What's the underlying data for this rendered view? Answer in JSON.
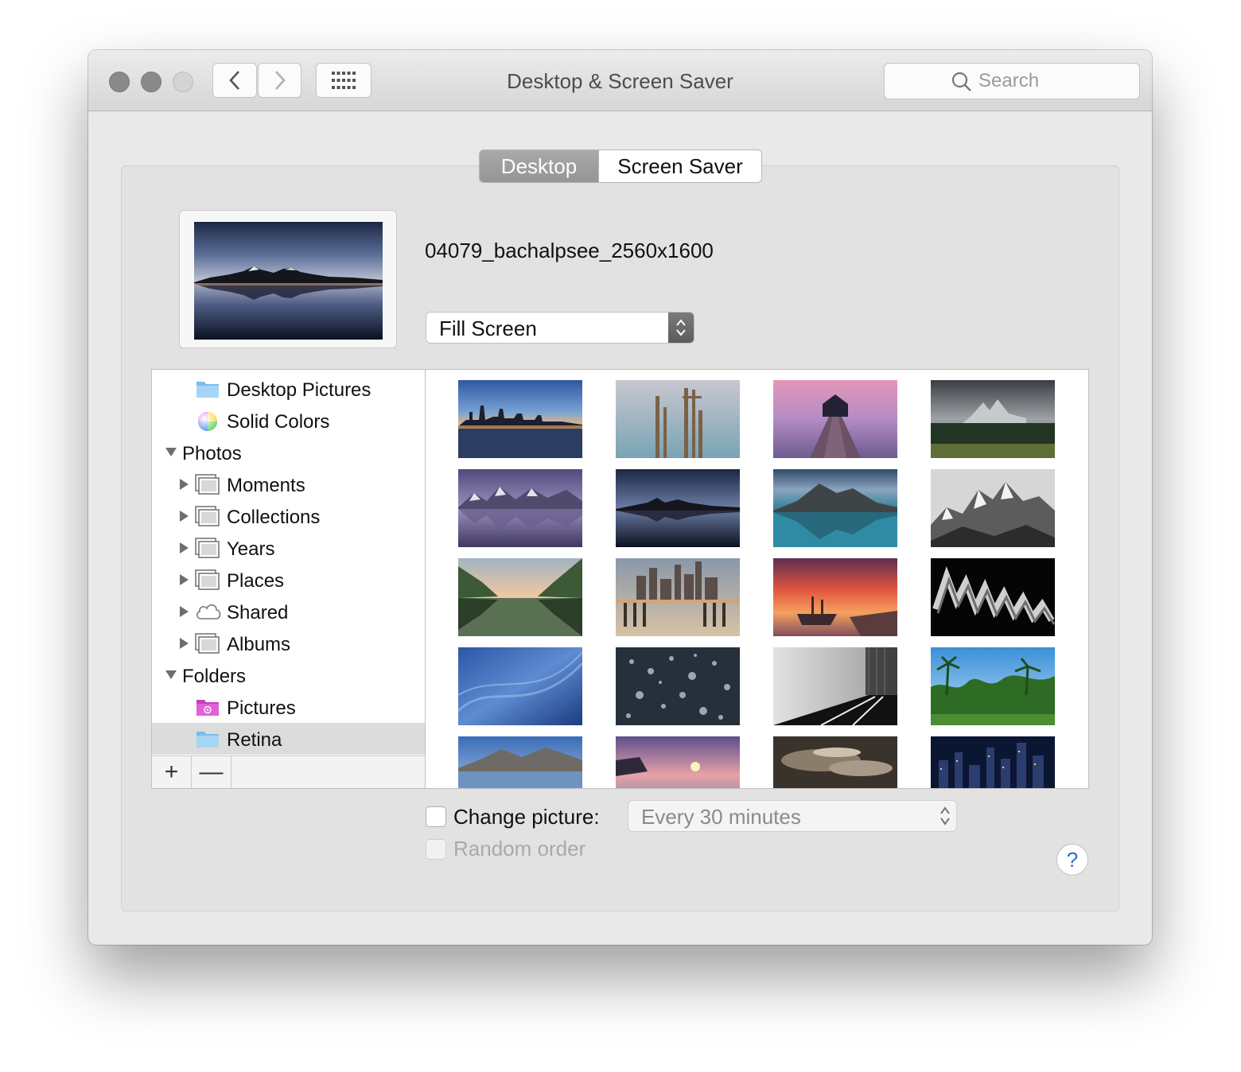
{
  "window": {
    "title": "Desktop & Screen Saver"
  },
  "search": {
    "placeholder": "Search"
  },
  "tabs": [
    {
      "label": "Desktop",
      "selected": true
    },
    {
      "label": "Screen Saver",
      "selected": false
    }
  ],
  "current": {
    "file_name": "04079_bachalpsee_2560x1600",
    "fit_mode": "Fill Screen"
  },
  "sources": [
    {
      "label": "Desktop Pictures",
      "icon": "blue-folder-icon",
      "disclosure": "none"
    },
    {
      "label": "Solid Colors",
      "icon": "color-wheel-icon",
      "disclosure": "none"
    },
    {
      "label": "Photos",
      "icon": "",
      "disclosure": "expanded"
    },
    {
      "label": "Moments",
      "icon": "photo-stack-icon",
      "disclosure": "collapsed"
    },
    {
      "label": "Collections",
      "icon": "photo-stack-icon",
      "disclosure": "collapsed"
    },
    {
      "label": "Years",
      "icon": "photo-stack-icon",
      "disclosure": "collapsed"
    },
    {
      "label": "Places",
      "icon": "photo-stack-icon",
      "disclosure": "collapsed"
    },
    {
      "label": "Shared",
      "icon": "cloud-icon",
      "disclosure": "collapsed"
    },
    {
      "label": "Albums",
      "icon": "photo-stack-icon",
      "disclosure": "collapsed"
    },
    {
      "label": "Folders",
      "icon": "",
      "disclosure": "expanded"
    },
    {
      "label": "Pictures",
      "icon": "pink-pictures-folder-icon",
      "disclosure": "none"
    },
    {
      "label": "Retina",
      "icon": "blue-folder-icon",
      "disclosure": "none",
      "selected": true
    }
  ],
  "source_buttons": {
    "add": "+",
    "remove": "—"
  },
  "thumbnails": [
    "city-skyline-dusk",
    "wooden-pier-posts",
    "boathouse-jetty-purple",
    "misty-mountain-forest",
    "purple-mountain-reflection",
    "bachalpsee-lake-dusk",
    "blue-mountain-lake",
    "bw-rocky-peaks",
    "valley-lake-reflection",
    "city-pier-sunset",
    "shipwreck-sunset",
    "abstract-zigzag-dark",
    "blue-abstract-waves",
    "water-drops-dark",
    "bw-perspective-lines",
    "tropical-palms",
    "mountain-lake-blue",
    "coast-sunset",
    "stormy-clouds-sepia",
    "city-night-skyline"
  ],
  "change_picture": {
    "label": "Change picture:",
    "checked": false,
    "interval": "Every 30 minutes"
  },
  "random_order": {
    "label": "Random order",
    "checked": false,
    "enabled": false
  },
  "help_label": "?",
  "colors": {
    "accent": "#2d6bd6",
    "selected_tab": "#9f9f9f",
    "selection": "#dcdcdc"
  }
}
